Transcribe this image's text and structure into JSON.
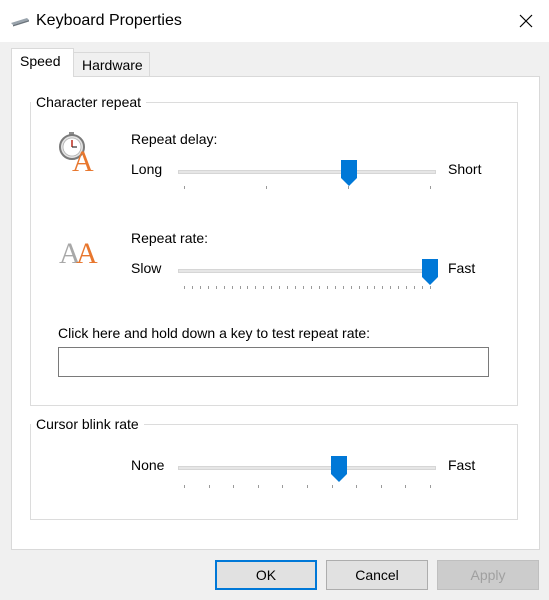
{
  "window": {
    "title": "Keyboard Properties",
    "title_icon": "keyboard-icon",
    "close_icon": "close-icon"
  },
  "tabs": [
    {
      "label": "Speed",
      "active": true
    },
    {
      "label": "Hardware",
      "active": false
    }
  ],
  "character_repeat": {
    "group_label": "Character repeat",
    "repeat_delay": {
      "label": "Repeat delay:",
      "icon": "stopwatch-letter-icon",
      "min_label": "Long",
      "max_label": "Short",
      "value_fraction": 0.67,
      "tick_count": 4
    },
    "repeat_rate": {
      "label": "Repeat rate:",
      "icon": "double-letter-icon",
      "min_label": "Slow",
      "max_label": "Fast",
      "value_fraction": 1.0,
      "tick_count": 32
    },
    "test": {
      "label": "Click here and hold down a key to test repeat rate:",
      "value": ""
    }
  },
  "cursor_blink": {
    "group_label": "Cursor blink rate",
    "min_label": "None",
    "max_label": "Fast",
    "value_fraction": 0.63,
    "tick_count": 11
  },
  "buttons": {
    "ok": "OK",
    "cancel": "Cancel",
    "apply": "Apply"
  },
  "colors": {
    "accent": "#0078d7",
    "icon_orange": "#e8772e"
  }
}
